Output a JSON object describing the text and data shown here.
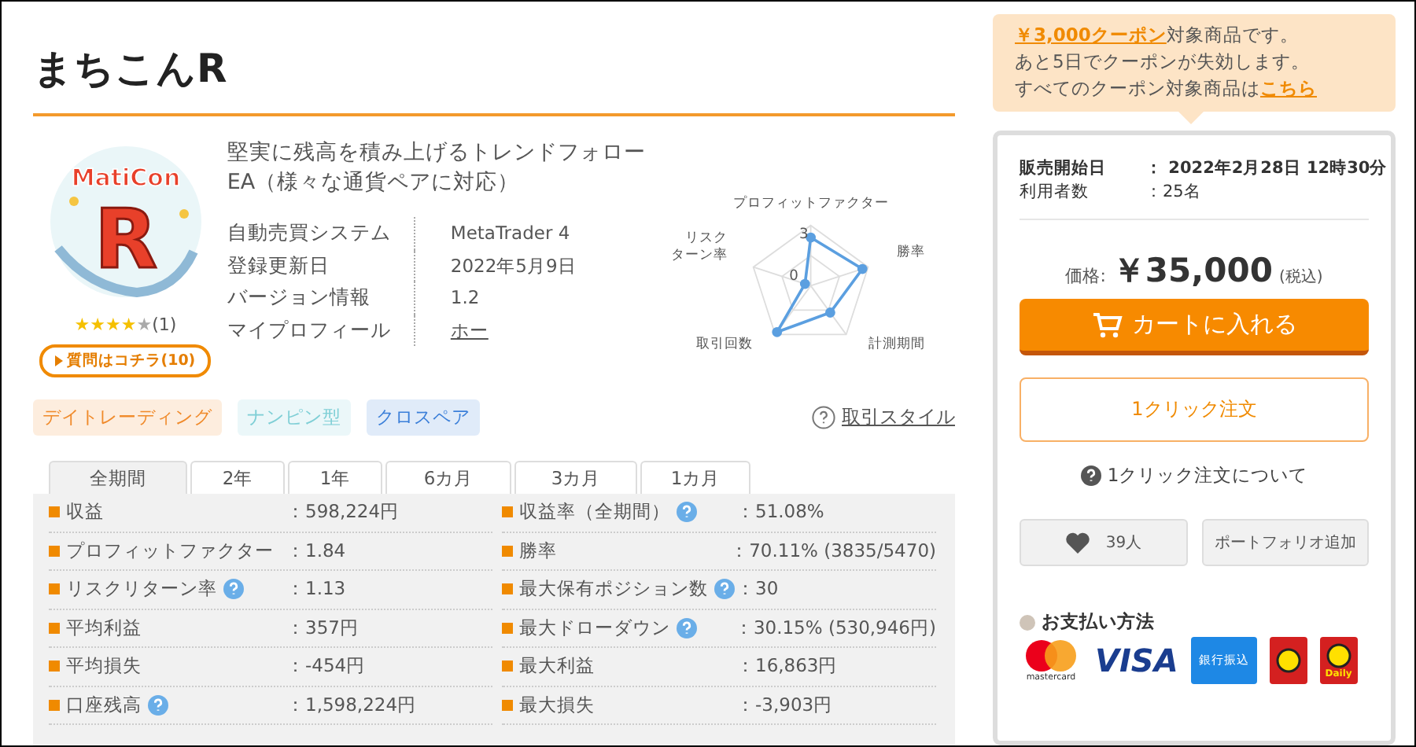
{
  "title": "まちこんR",
  "product": {
    "tagline": "堅実に残高を積み上げるトレンドフォローEA（様々な通貨ペアに対応）",
    "stars": 4,
    "review_count": "(1)",
    "question_button": "質問はコチラ(10)",
    "logo_text": "MatiCon",
    "logo_letter": "R"
  },
  "info": [
    {
      "label": "自動売買システム",
      "value": "MetaTrader 4",
      "kind": "text"
    },
    {
      "label": "登録更新日",
      "value": "2022年5月9日",
      "kind": "text"
    },
    {
      "label": "バージョン情報",
      "value": "1.2",
      "kind": "text"
    },
    {
      "label": "マイプロフィール",
      "value": "ホー",
      "kind": "link"
    }
  ],
  "radar": {
    "axes": [
      [
        "プロフィットファクター"
      ],
      [
        "勝率"
      ],
      [
        "計測期間"
      ],
      [
        "取引回数"
      ],
      [
        "リスク",
        "ターン率"
      ]
    ],
    "tick_labels": [
      "3",
      "0"
    ]
  },
  "tags": [
    {
      "label": "デイトレーディング",
      "color": "#f08a2a"
    },
    {
      "label": "ナンピン型",
      "color": "#7fcfd6"
    },
    {
      "label": "クロスペア",
      "color": "#3b7fd9"
    }
  ],
  "style_link": "取引スタイル",
  "tabs": [
    {
      "label": "全期間",
      "selected": true
    },
    {
      "label": "2年",
      "selected": false
    },
    {
      "label": "1年",
      "selected": false
    },
    {
      "label": "6カ月",
      "selected": false
    },
    {
      "label": "3カ月",
      "selected": false
    },
    {
      "label": "1カ月",
      "selected": false
    }
  ],
  "stats_left": [
    {
      "label": "収益",
      "value": "：598,224円",
      "help": false
    },
    {
      "label": "プロフィットファクター",
      "value": "：1.84",
      "help": false
    },
    {
      "label": "リスクリターン率",
      "value": "：1.13",
      "help": true
    },
    {
      "label": "平均利益",
      "value": "：357円",
      "help": false
    },
    {
      "label": "平均損失",
      "value": "：-454円",
      "help": false
    },
    {
      "label": "口座残高",
      "value": "：1,598,224円",
      "help": true
    }
  ],
  "stats_right": [
    {
      "label": "収益率（全期間）",
      "value": "：51.08%",
      "help": true
    },
    {
      "label": "勝率",
      "value": "：70.11% (3835/5470)",
      "help": false
    },
    {
      "label": "最大保有ポジション数",
      "value": "：30",
      "help": true
    },
    {
      "label": "最大ドローダウン",
      "value": "：30.15% (530,946円)",
      "help": true
    },
    {
      "label": "最大利益",
      "value": "：16,863円",
      "help": false
    },
    {
      "label": "最大損失",
      "value": "：-3,903円",
      "help": false
    }
  ],
  "coupon": {
    "link": "￥3,000クーポン",
    "line1_rest": "対象商品です。",
    "line2": "あと5日でクーポンが失効します。",
    "line3": "すべてのクーポン対象商品は",
    "line3_link": "こちら"
  },
  "sale": [
    {
      "label": "販売開始日",
      "value": "：  2022年2月28日 12時30分",
      "bold": true
    },
    {
      "label": "利用者数",
      "value": "：25名",
      "bold": false
    }
  ],
  "price": {
    "label": "価格:",
    "amount": "￥35,000",
    "tax": "(税込)"
  },
  "cart_button": "カートに入れる",
  "one_click_button": "1クリック注文",
  "one_click_help": "1クリック注文について",
  "favorite_button": "39人",
  "portfolio_button": "ポートフォリオ追加",
  "payment": {
    "title": "お支払い方法",
    "methods": [
      {
        "kind": "mastercard",
        "label": "mastercard"
      },
      {
        "kind": "visa",
        "label": "VISA"
      },
      {
        "kind": "bank",
        "label": "銀行振込"
      },
      {
        "kind": "daily"
      },
      {
        "kind": "daily",
        "label": "Daily"
      }
    ]
  }
}
